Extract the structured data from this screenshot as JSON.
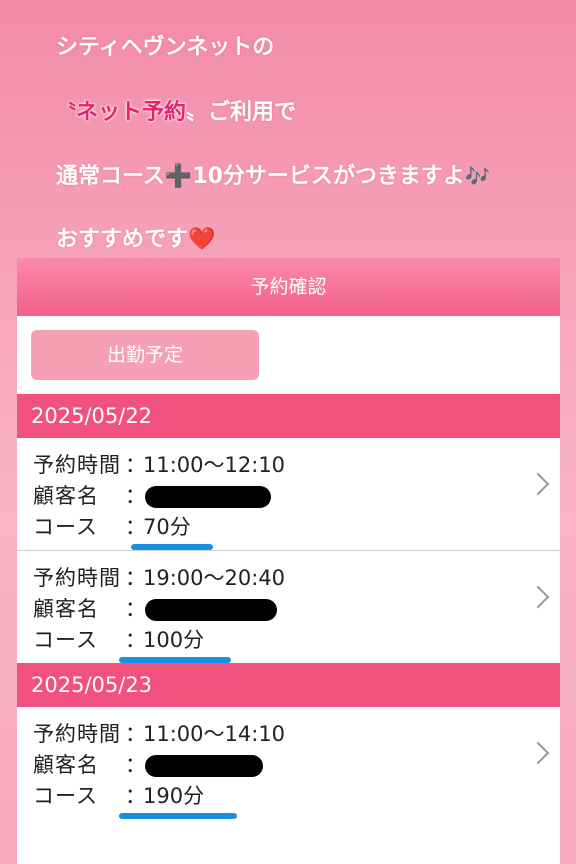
{
  "promo": {
    "line1": "シティヘヴンネットの",
    "line2_prefix": "〝",
    "line2_highlight": "ネット予約",
    "line2_suffix": "〟ご利用で",
    "line3_a": "通常コース",
    "line3_plus": "➕",
    "line3_b": "10分サービスがつきますよ",
    "line3_notes": "🎶",
    "line4": "おすすめです",
    "line4_heart": "❤️"
  },
  "panel": {
    "title": "予約確認",
    "schedule_button": "出勤予定"
  },
  "labels": {
    "time": "予約時間",
    "customer": "顧客名",
    "course": "コース",
    "colon": "："
  },
  "days": [
    {
      "date": "2025/05/22",
      "bookings": [
        {
          "time": "11:00〜12:10",
          "course": "70分"
        },
        {
          "time": "19:00〜20:40",
          "course": "100分"
        }
      ]
    },
    {
      "date": "2025/05/23",
      "bookings": [
        {
          "time": "11:00〜14:10",
          "course": "190分"
        }
      ]
    }
  ],
  "colors": {
    "accent": "#f1517f",
    "header": "#f35f8c",
    "button": "#f5a0b4",
    "underline": "#1a8fe0"
  }
}
